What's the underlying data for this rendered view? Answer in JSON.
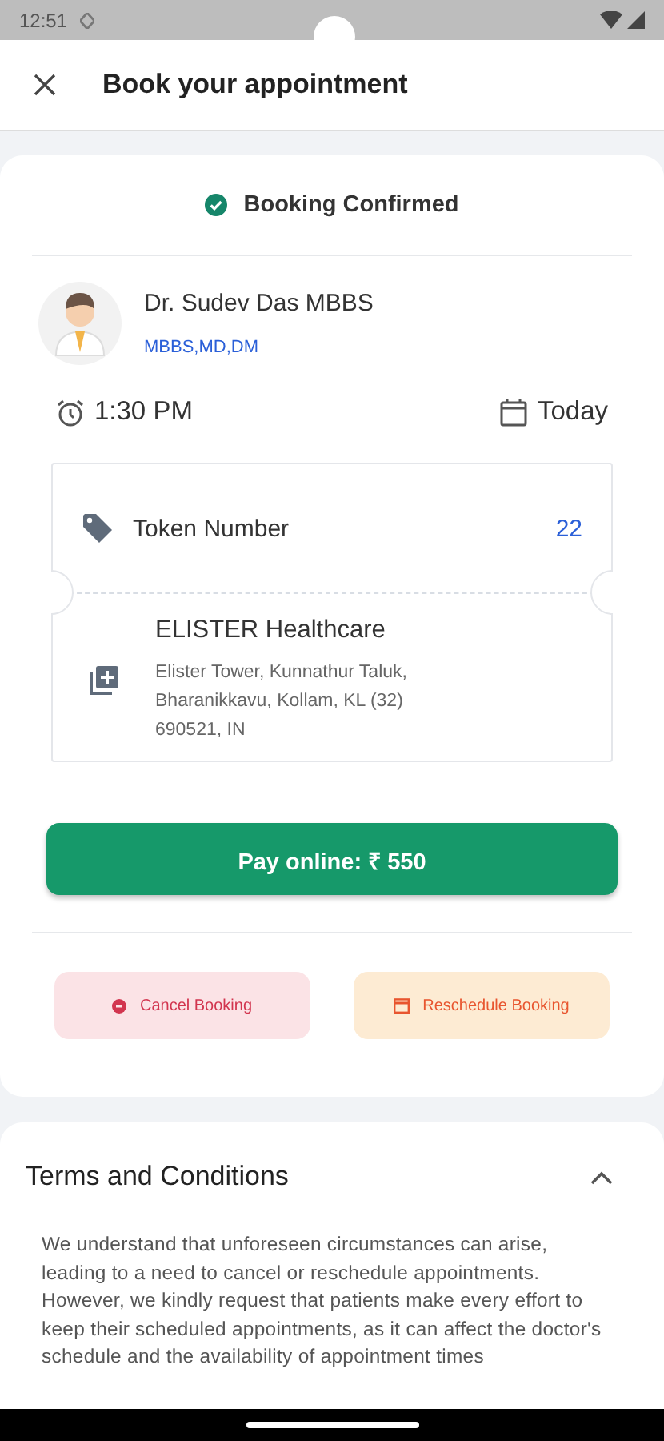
{
  "status_bar": {
    "time": "12:51"
  },
  "header": {
    "title": "Book your appointment"
  },
  "booking": {
    "status": "Booking Confirmed",
    "confirmed": true,
    "doctor": {
      "name": "Dr. Sudev Das MBBS",
      "qualifications": "MBBS,MD,DM"
    },
    "time": "1:30 PM",
    "date": "Today",
    "token": {
      "label": "Token Number",
      "value": "22"
    },
    "clinic": {
      "name": "ELISTER Healthcare",
      "address": "Elister Tower, Kunnathur Taluk, Bharanikkavu, Kollam, KL (32) 690521, IN"
    },
    "pay_button": "Pay online:  ₹ 550",
    "actions": [
      {
        "kind": "cancel",
        "label": "Cancel Booking"
      },
      {
        "kind": "reschedule",
        "label": "Reschedule Booking"
      }
    ]
  },
  "terms": {
    "title": "Terms and Conditions",
    "expanded": true,
    "text": "We understand that unforeseen circumstances can arise, leading to a need to cancel or reschedule appointments. However, we kindly request that patients make every effort to keep their scheduled appointments, as it can affect the doctor's schedule and the availability of appointment times"
  }
}
